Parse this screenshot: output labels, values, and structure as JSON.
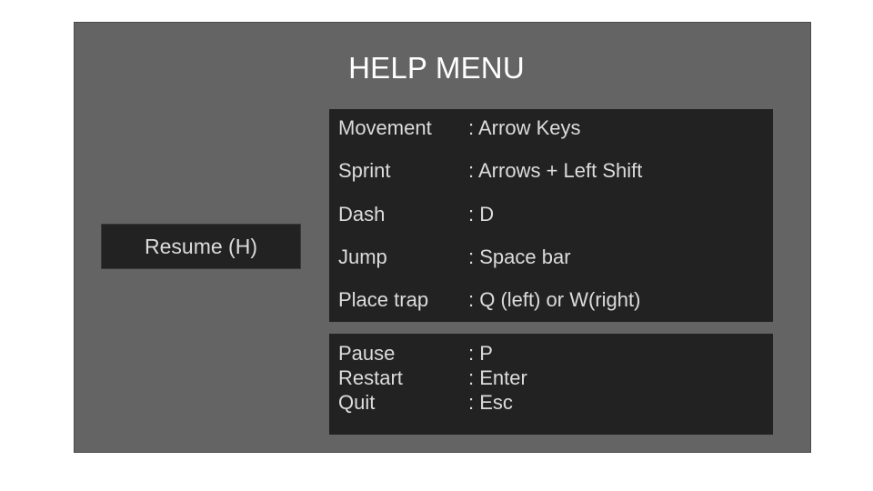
{
  "title": "HELP MENU",
  "resume_label": "Resume (H)",
  "controls": [
    {
      "action": "Movement",
      "binding": ": Arrow Keys"
    },
    {
      "action": "Sprint",
      "binding": ": Arrows + Left Shift"
    },
    {
      "action": "Dash",
      "binding": ": D"
    },
    {
      "action": "Jump",
      "binding": ": Space bar"
    },
    {
      "action": "Place trap",
      "binding": ": Q (left) or W(right)"
    }
  ],
  "system": [
    {
      "action": "Pause",
      "binding": ": P"
    },
    {
      "action": "Restart",
      "binding": ": Enter"
    },
    {
      "action": "Quit",
      "binding": ": Esc"
    }
  ],
  "colors": {
    "background": "#646464",
    "panel": "#222222",
    "text": "#dcdcdc",
    "title": "#ffffff"
  }
}
